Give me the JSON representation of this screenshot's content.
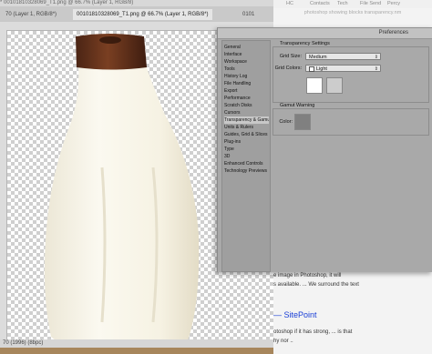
{
  "photoshop": {
    "title_line": "* 00101810328069_T1.png @ 66.7% (Layer 1, RGB/8)",
    "tabs": [
      {
        "label": "70 (Layer 1, RGB/8*)"
      },
      {
        "label": "00101810328069_T1.png @ 66.7% (Layer 1, RGB/8*)"
      },
      {
        "label": "0101"
      }
    ],
    "status": "Doc: 1.21M/1.09M",
    "status_left": "70 (1996) (8bpc)"
  },
  "browser": {
    "nav": [
      "HC",
      "Contacts",
      "Tech",
      "File Send",
      "Percy"
    ],
    "address": "photoshop showing blocks transparency.nm",
    "lines": [
      {
        "text": "e image in Photoshop, it will"
      },
      {
        "text": "s available. ... We surround the text"
      },
      {
        "text": "otoshop if it has strong, ... is that"
      },
      {
        "text": "hy nor .."
      }
    ],
    "link": "— SitePoint"
  },
  "preferences": {
    "title": "Preferences",
    "sidebar": [
      {
        "label": "General",
        "selected": false
      },
      {
        "label": "Interface",
        "selected": false
      },
      {
        "label": "Workspace",
        "selected": false
      },
      {
        "label": "Tools",
        "selected": false
      },
      {
        "label": "History Log",
        "selected": false
      },
      {
        "label": "File Handling",
        "selected": false
      },
      {
        "label": "Export",
        "selected": false
      },
      {
        "label": "Performance",
        "selected": false
      },
      {
        "label": "Scratch Disks",
        "selected": false
      },
      {
        "label": "Cursors",
        "selected": false
      },
      {
        "label": "Transparency & Gamut",
        "selected": true
      },
      {
        "label": "Units & Rulers",
        "selected": false
      },
      {
        "label": "Guides, Grid & Slices",
        "selected": false
      },
      {
        "label": "Plug-ins",
        "selected": false
      },
      {
        "label": "Type",
        "selected": false
      },
      {
        "label": "3D",
        "selected": false
      },
      {
        "label": "Enhanced Controls",
        "selected": false
      },
      {
        "label": "Technology Previews",
        "selected": false
      }
    ],
    "transparency": {
      "heading": "Transparency Settings",
      "grid_size_label": "Grid Size:",
      "grid_size_value": "Medium",
      "grid_colors_label": "Grid Colors:",
      "grid_colors_value": "Light",
      "swatch_1": "#ffffff",
      "swatch_2": "#cccccc"
    },
    "gamut": {
      "heading": "Gamut Warning",
      "color_label": "Color:",
      "color_value": "#808080"
    }
  }
}
